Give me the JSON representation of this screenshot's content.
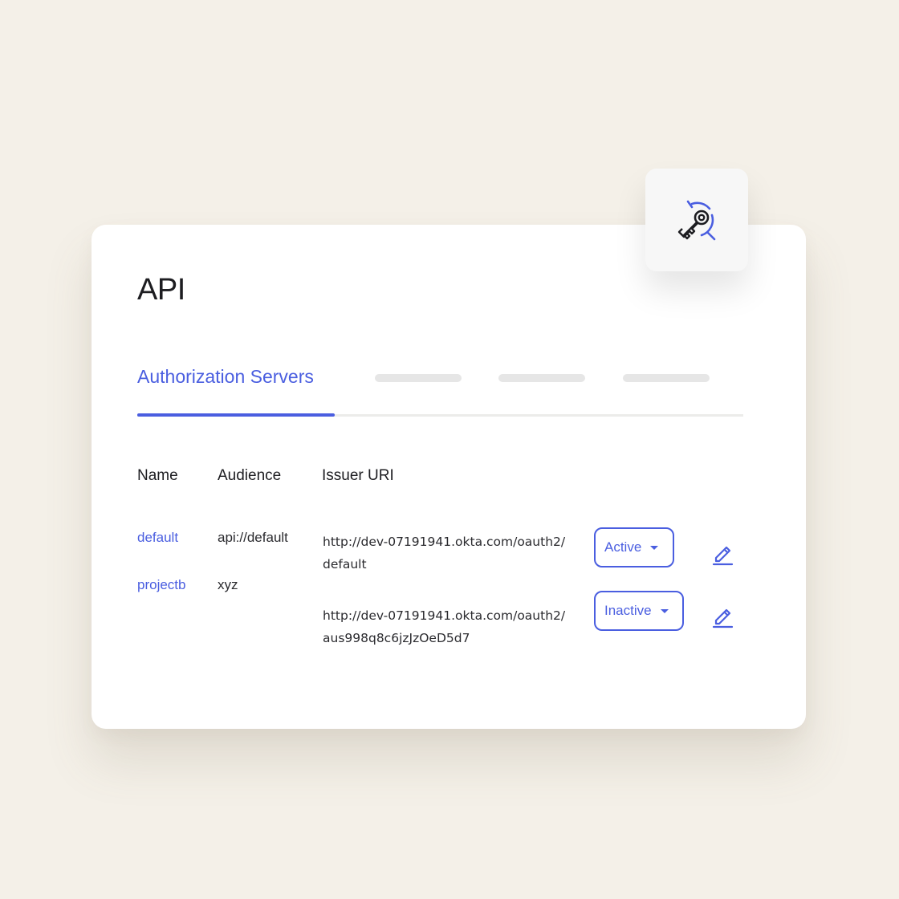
{
  "page": {
    "title": "API"
  },
  "tabs": {
    "active_label": "Authorization Servers"
  },
  "table": {
    "headers": {
      "name": "Name",
      "audience": "Audience",
      "issuer": "Issuer URI"
    },
    "rows": [
      {
        "name": "default",
        "audience": "api://default",
        "issuer_line1": "http://dev-07191941.okta.com/oauth2/",
        "issuer_line2": "default",
        "status": "Active"
      },
      {
        "name": "projectb",
        "audience": "xyz",
        "issuer_line1": "http://dev-07191941.okta.com/oauth2/",
        "issuer_line2": "aus998q8c6jzJzOeD5d7",
        "status": "Inactive"
      }
    ]
  },
  "icons": {
    "feature": "key-search-icon",
    "edit": "pencil-icon",
    "dropdown": "caret-down-icon"
  },
  "colors": {
    "accent": "#4a5ee0",
    "text": "#1d1d21",
    "background": "#f4f0e8"
  }
}
